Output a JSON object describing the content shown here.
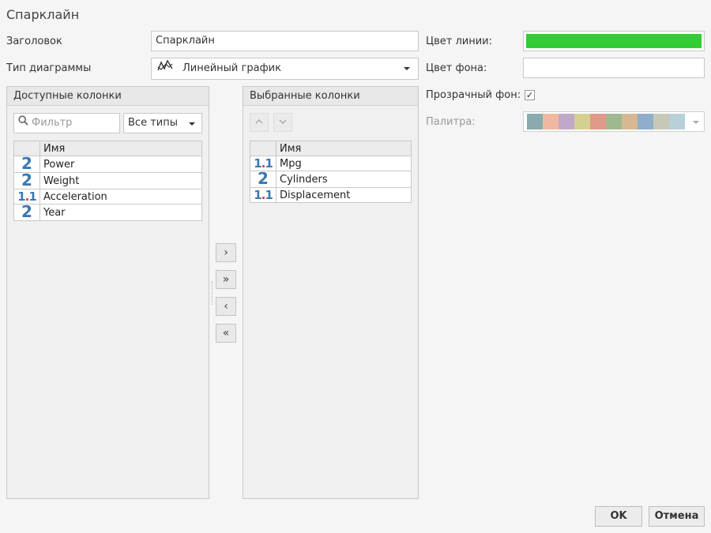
{
  "dialog": {
    "title": "Спарклайн"
  },
  "form": {
    "title_label": "Заголовок",
    "title_value": "Спарклайн",
    "chart_type_label": "Тип диаграммы",
    "chart_type_value": "Линейный график",
    "line_color_label": "Цвет линии:",
    "line_color": "#33cc33",
    "bg_color_label": "Цвет фона:",
    "transparent_label": "Прозрачный фон:",
    "transparent_checked": "✓",
    "palette_label": "Палитра:",
    "palette": [
      "#8aabad",
      "#f0b8a0",
      "#c0a8c8",
      "#d4d090",
      "#e09a8a",
      "#a0b890",
      "#d8b890",
      "#8eaecc",
      "#c8c8b8",
      "#b8d0d8"
    ]
  },
  "available": {
    "header": "Доступные колонки",
    "filter_placeholder": "Фильтр",
    "types_label": "Все типы",
    "col_name": "Имя",
    "rows": [
      {
        "type": "2",
        "name": "Power"
      },
      {
        "type": "2",
        "name": "Weight"
      },
      {
        "type": "1.1",
        "name": "Acceleration"
      },
      {
        "type": "2",
        "name": "Year"
      }
    ]
  },
  "selected": {
    "header": "Выбранные колонки",
    "col_name": "Имя",
    "rows": [
      {
        "type": "1.1",
        "name": "Mpg"
      },
      {
        "type": "2",
        "name": "Cylinders"
      },
      {
        "type": "1.1",
        "name": "Displacement"
      }
    ]
  },
  "transfer": {
    "add_one": "›",
    "add_all": "»",
    "remove_one": "‹",
    "remove_all": "«"
  },
  "footer": {
    "ok": "OK",
    "cancel": "Отмена"
  }
}
